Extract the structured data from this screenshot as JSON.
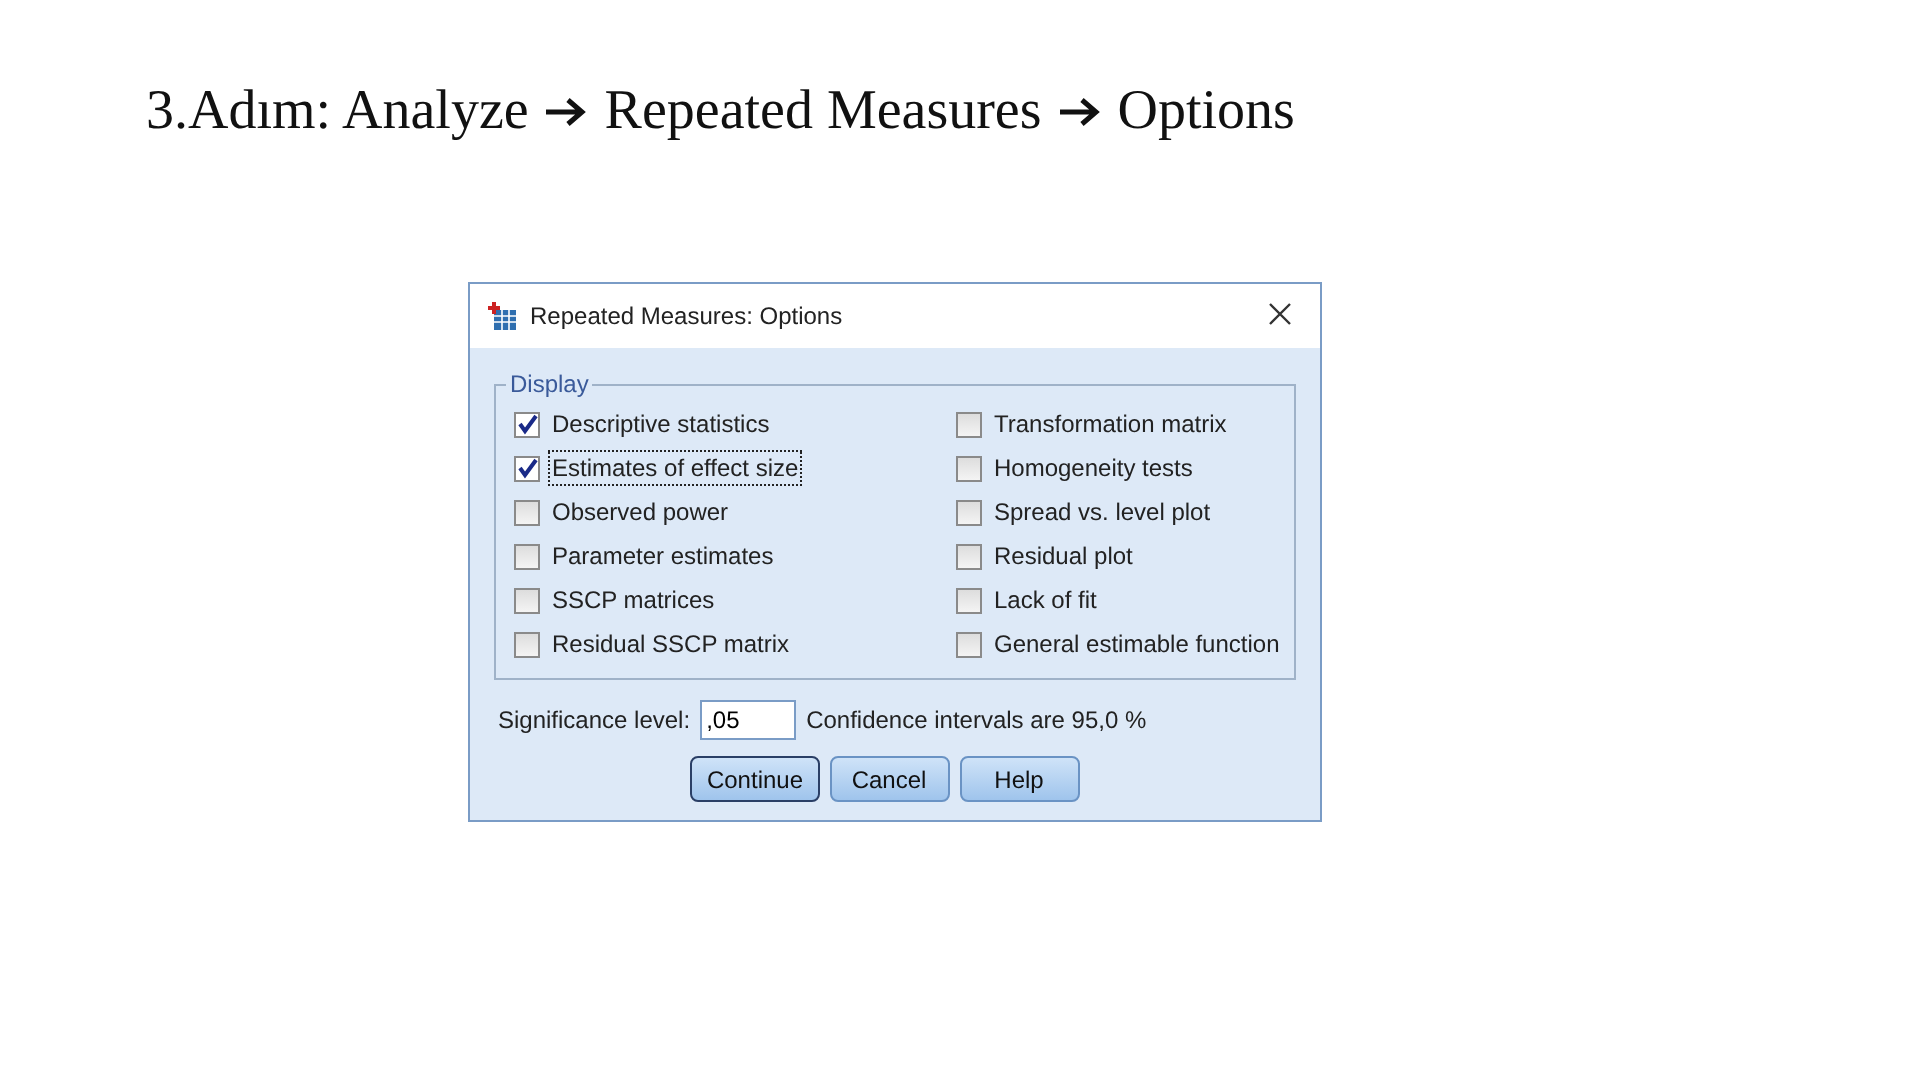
{
  "heading": {
    "step": "3.Adım: Analyze",
    "parts": [
      "Repeated Measures",
      "Options"
    ]
  },
  "dialog": {
    "title": "Repeated Measures: Options",
    "display_group": {
      "title": "Display",
      "options": [
        {
          "label": "Descriptive statistics",
          "checked": true,
          "focused": false
        },
        {
          "label": "Estimates of effect size",
          "checked": true,
          "focused": true
        },
        {
          "label": "Observed power",
          "checked": false,
          "focused": false
        },
        {
          "label": "Parameter estimates",
          "checked": false,
          "focused": false
        },
        {
          "label": "SSCP matrices",
          "checked": false,
          "focused": false
        },
        {
          "label": "Residual SSCP matrix",
          "checked": false,
          "focused": false
        },
        {
          "label": "Transformation matrix",
          "checked": false,
          "focused": false
        },
        {
          "label": "Homogeneity tests",
          "checked": false,
          "focused": false
        },
        {
          "label": "Spread vs. level plot",
          "checked": false,
          "focused": false
        },
        {
          "label": "Residual plot",
          "checked": false,
          "focused": false
        },
        {
          "label": "Lack of fit",
          "checked": false,
          "focused": false
        },
        {
          "label": "General estimable function",
          "checked": false,
          "focused": false
        }
      ]
    },
    "significance": {
      "label": "Significance level:",
      "value": ",05",
      "note": "Confidence intervals are 95,0 %"
    },
    "buttons": [
      {
        "label": "Continue",
        "default": true
      },
      {
        "label": "Cancel",
        "default": false
      },
      {
        "label": "Help",
        "default": false
      }
    ]
  }
}
